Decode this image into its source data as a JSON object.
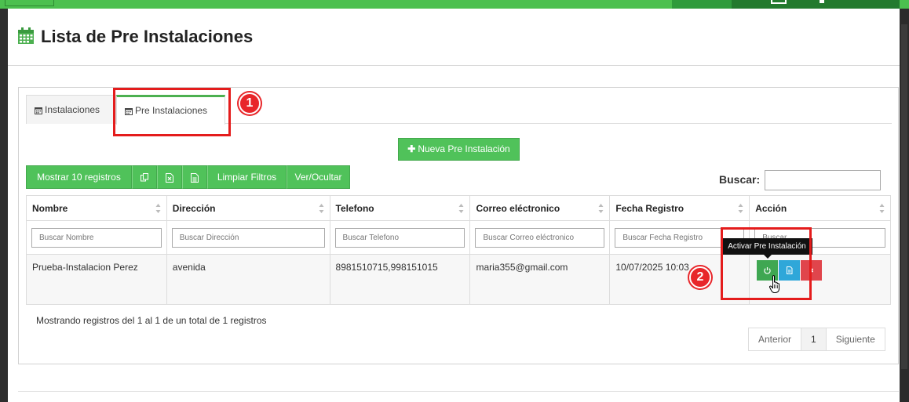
{
  "page": {
    "title": "Lista de Pre Instalaciones"
  },
  "tabs": [
    {
      "label": "Instalaciones"
    },
    {
      "label": "Pre Instalaciones"
    }
  ],
  "new_button": {
    "label": "Nueva Pre Instalación"
  },
  "toolbar": {
    "show_records": "Mostrar 10 registros",
    "clear_filters": "Limpiar Filtros",
    "toggle_columns": "Ver/Ocultar"
  },
  "search": {
    "label": "Buscar:",
    "value": ""
  },
  "table": {
    "headers": [
      "Nombre",
      "Dirección",
      "Telefono",
      "Correo eléctronico",
      "Fecha Registro",
      "Acción"
    ],
    "filters": [
      "Buscar Nombre",
      "Buscar Dirección",
      "Buscar Telefono",
      "Buscar Correo eléctronico",
      "Buscar Fecha Registro",
      "Buscar"
    ],
    "rows": [
      {
        "nombre": "Prueba-Instalacion Perez",
        "direccion": "avenida",
        "telefono": "8981510715,998151015",
        "correo": "maria355@gmail.com",
        "fecha": "10/07/2025 10:03"
      }
    ]
  },
  "footer": {
    "info": "Mostrando registros del 1 al 1 de un total de 1 registros",
    "pagination": {
      "previous": "Anterior",
      "current": "1",
      "next": "Siguiente"
    }
  },
  "tooltip": {
    "text": "Activar Pre Instalación"
  },
  "annotations": {
    "badge1": "1",
    "badge2": "2"
  },
  "colors": {
    "brand_green": "#50c25a",
    "action_green": "#3fa752",
    "action_blue": "#2fa7d9",
    "action_red": "#e0454c",
    "annotation_red": "#e41c1c"
  },
  "icons": {
    "title": "calendar-icon",
    "tab": "calendar-icon",
    "new": "plus-icon",
    "copy": "copy-icon",
    "excel": "excel-icon",
    "pdf": "document-icon",
    "activate": "power-icon",
    "view": "document-icon",
    "delete": "close-icon",
    "cursor": "hand-cursor-icon"
  }
}
